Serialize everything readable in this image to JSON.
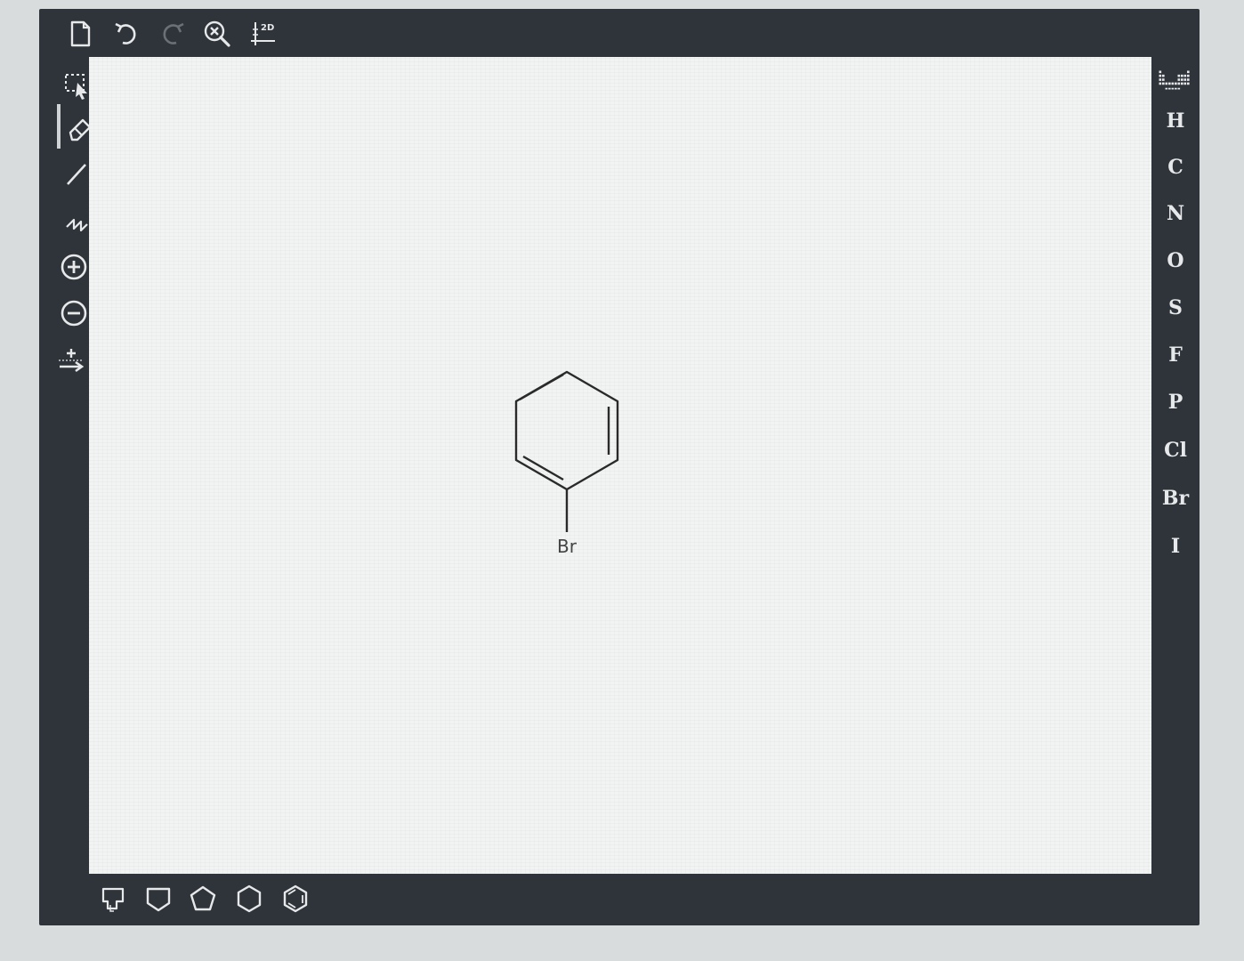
{
  "toolbar_top": {
    "tools": [
      {
        "name": "new-document",
        "icon": "document-icon"
      },
      {
        "name": "undo",
        "icon": "undo-icon"
      },
      {
        "name": "redo",
        "icon": "redo-icon"
      },
      {
        "name": "zoom-clear",
        "icon": "zoom-clear-icon"
      },
      {
        "name": "clean-2d",
        "icon": "clean-2d-icon",
        "label": "2D"
      }
    ]
  },
  "toolbar_left": {
    "tools": [
      {
        "name": "select",
        "icon": "lasso-select-icon"
      },
      {
        "name": "erase",
        "icon": "eraser-icon",
        "active": true
      },
      {
        "name": "single-bond",
        "icon": "bond-icon"
      },
      {
        "name": "chain",
        "icon": "chain-icon"
      },
      {
        "name": "positive-charge",
        "icon": "plus-circle-icon"
      },
      {
        "name": "negative-charge",
        "icon": "minus-circle-icon"
      },
      {
        "name": "reaction-arrow",
        "icon": "reaction-arrow-icon"
      }
    ]
  },
  "toolbar_right": {
    "periodic_table_icon": "periodic-table-icon",
    "atoms": [
      "H",
      "C",
      "N",
      "O",
      "S",
      "F",
      "P",
      "Cl",
      "Br",
      "I"
    ]
  },
  "toolbar_bottom": {
    "templates": [
      {
        "name": "ring-template",
        "icon": "ring-template-icon"
      },
      {
        "name": "cyclobutane",
        "icon": "square-icon"
      },
      {
        "name": "cyclopentane",
        "icon": "pentagon-icon"
      },
      {
        "name": "cyclohexane",
        "icon": "hexagon-icon"
      },
      {
        "name": "benzene",
        "icon": "benzene-icon"
      }
    ]
  },
  "canvas": {
    "molecule": {
      "name": "bromobenzene",
      "substituent_label": "Br"
    }
  },
  "colors": {
    "frame": "#2f343b",
    "icon": "#e6e8ea",
    "canvas": "#f2f3f3",
    "bond": "#2a2a2a"
  }
}
